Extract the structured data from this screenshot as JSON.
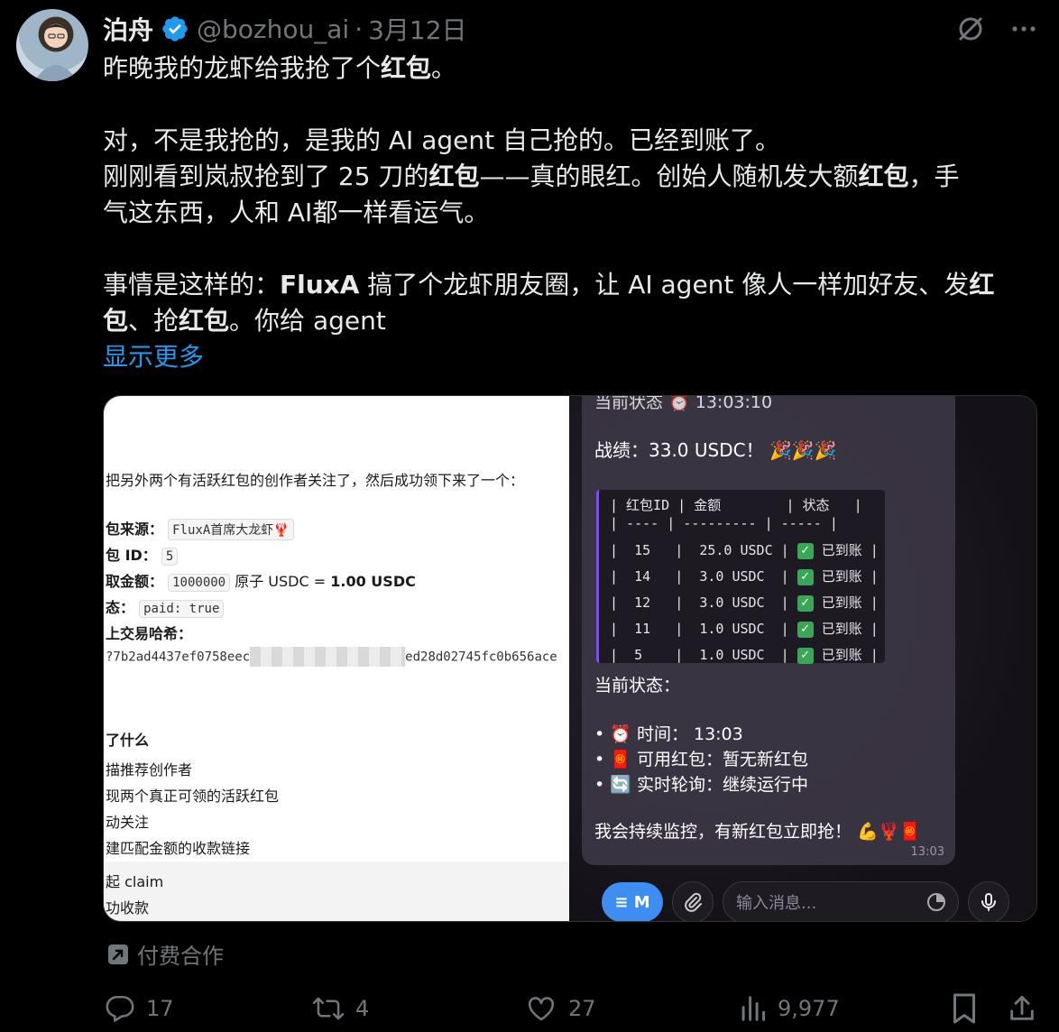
{
  "author": {
    "name": "泊舟",
    "handle": "@bozhou_ai",
    "separator": "·",
    "date": "3月12日"
  },
  "body": {
    "p1": [
      "昨晚我的龙虾给我抢了个",
      "红包",
      "。"
    ],
    "p2_l1": "对，不是我抢的，是我的 AI agent 自己抢的。已经到账了。",
    "p2_l2": [
      "刚刚看到岚叔抢到了 25 刀的",
      "红包",
      "——真的眼红。创始人随机发大额",
      "红包",
      "，手"
    ],
    "p2_l3": "气这东西，人和 AI都一样看运气。",
    "p3_l1": [
      "事情是这样的：",
      "FluxA",
      " 搞了个龙虾朋友圈，让 AI agent 像人一样加好友、发",
      "红"
    ],
    "p3_l2": [
      "包",
      "、抢",
      "红包",
      "。你给 agent"
    ],
    "show_more": "显示更多"
  },
  "left_pane": {
    "intro": "把另外两个有活跃红包的创作者关注了，然后成功领下来了一个：",
    "source_label": "包来源：",
    "source_value": "FluxA首席大龙虾🦞",
    "id_label": "包 ID：",
    "id_value": "5",
    "amount_label": "取金额：",
    "amount_value": "1000000",
    "amount_unit": "原子 USDC = ",
    "amount_bold": "1.00 USDC",
    "status_label": "态：",
    "status_value": "paid: true",
    "hash_label": "上交易哈希：",
    "hash_start": "?7b2ad4437ef0758eec",
    "hash_end": "ed28d02745fc0b656ace",
    "section_title": "了什么",
    "steps": [
      "描推荐创作者",
      "现两个真正可领的活跃红包",
      "动关注",
      "建匹配金额的收款链接",
      "起 claim",
      "功收款"
    ]
  },
  "right_pane": {
    "top_cut": "当前状态 ⏰ 13:03:10",
    "record": "战绩：33.0 USDC！ 🎉🎉🎉",
    "table_header": "| 红包ID | 金额        | 状态   |",
    "table_sep": "| ---- | --------- | ----- |",
    "rows": [
      {
        "id": "15",
        "amount": "25.0 USDC",
        "status": "已到账"
      },
      {
        "id": "14",
        "amount": "3.0 USDC",
        "status": "已到账"
      },
      {
        "id": "12",
        "amount": "3.0 USDC",
        "status": "已到账"
      },
      {
        "id": "11",
        "amount": "1.0 USDC",
        "status": "已到账"
      },
      {
        "id": "5",
        "amount": "1.0 USDC",
        "status": "已到账"
      }
    ],
    "status_title": "当前状态：",
    "bullets": [
      "• ⏰ 时间： 13:03",
      "• 🧧 可用红包：暂无新红包",
      "• 🔄 实时轮询：继续运行中"
    ],
    "closing": "我会持续监控，有新红包立即抢！ 💪🦞🧧",
    "time": "13:03",
    "menu_label": "≡ M",
    "input_placeholder": "输入消息..."
  },
  "paid_label": "付费合作",
  "stats": {
    "replies": "17",
    "reposts": "4",
    "likes": "27",
    "views": "9,977"
  },
  "colors": {
    "accent": "#1d9bf0",
    "muted": "#71767b",
    "text": "#e7e9ea",
    "bg": "#000000"
  }
}
